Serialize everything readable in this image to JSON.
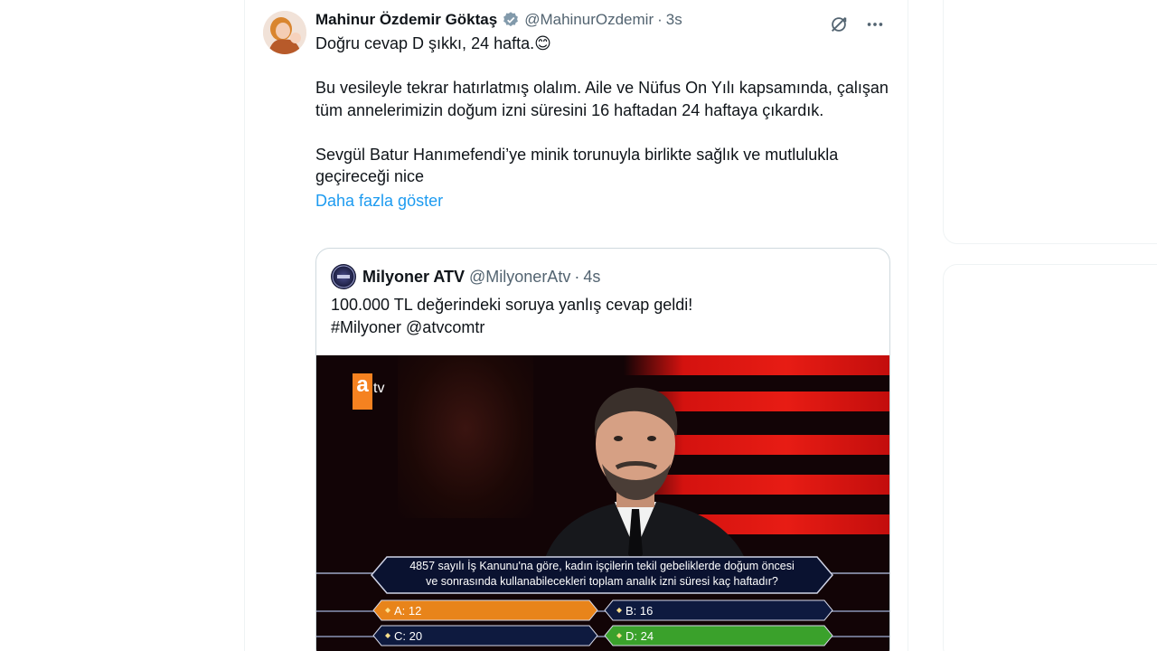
{
  "tweet": {
    "author_name": "Mahinur Özdemir Göktaş",
    "handle": "@MahinurOzdemir",
    "separator": "·",
    "time": "3s",
    "text": "Doğru cevap D şıkkı, 24 hafta.😊\n\nBu vesileyle tekrar hatırlatmış olalım. Aile ve Nüfus On Yılı kapsamında, çalışan tüm annelerimizin doğum izni süresini 16 haftadan 24 haftaya çıkardık.\n\nSevgül Batur Hanımefendi’ye minik torunuyla birlikte sağlık ve mutlulukla geçireceği nice",
    "show_more": "Daha fazla göster"
  },
  "quote": {
    "author_name": "Milyoner ATV",
    "handle": "@MilyonerAtv",
    "separator": "·",
    "time": "4s",
    "text": "100.000 TL değerindeki soruya yanlış cevap geldi!\n#Milyoner @atvcomtr"
  },
  "media": {
    "logo_a": "a",
    "logo_tv": "tv",
    "question_line1": "4857 sayılı İş Kanunu'na göre, kadın işçilerin tekil gebeliklerde doğum öncesi",
    "question_line2": "ve sonrasında kullanabilecekleri toplam analık izni süresi kaç haftadır?",
    "answers": [
      {
        "label": "A: 12",
        "state": "selected",
        "color": "#e8841a"
      },
      {
        "label": "B: 16",
        "state": "default",
        "color": "#0e1a3f"
      },
      {
        "label": "C: 20",
        "state": "default",
        "color": "#0e1a3f"
      },
      {
        "label": "D: 24",
        "state": "correct",
        "color": "#3aa12b"
      }
    ]
  },
  "colors": {
    "link": "#1d9bf0",
    "verified": "#829aab",
    "secondary_text": "#536471"
  }
}
